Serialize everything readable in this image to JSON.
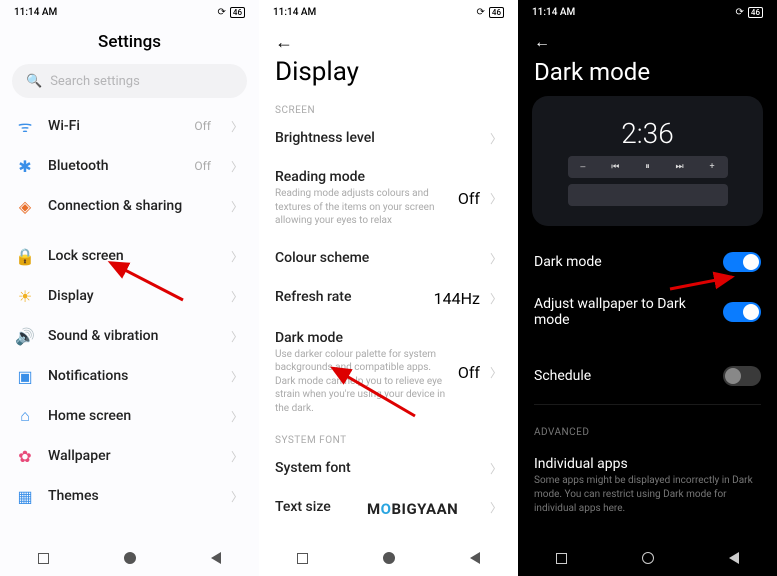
{
  "status": {
    "time": "11:14 AM",
    "batt": "46"
  },
  "p1": {
    "title": "Settings",
    "search_placeholder": "Search settings",
    "items": [
      {
        "icon": "wifi",
        "label": "Wi-Fi",
        "value": "Off",
        "color": "#3a8fe8"
      },
      {
        "icon": "bluetooth",
        "label": "Bluetooth",
        "value": "Off",
        "color": "#3a8fe8"
      },
      {
        "icon": "share",
        "label": "Connection & sharing",
        "value": "",
        "color": "#e86f2a"
      },
      {
        "gap": true
      },
      {
        "icon": "lock",
        "label": "Lock screen",
        "value": "",
        "color": "#e8502a"
      },
      {
        "icon": "sun",
        "label": "Display",
        "value": "",
        "color": "#f0b020"
      },
      {
        "icon": "sound",
        "label": "Sound & vibration",
        "value": "",
        "color": "#2fbf5a"
      },
      {
        "icon": "bell",
        "label": "Notifications",
        "value": "",
        "color": "#3a8fe8"
      },
      {
        "icon": "home",
        "label": "Home screen",
        "value": "",
        "color": "#3a8fe8"
      },
      {
        "icon": "flower",
        "label": "Wallpaper",
        "value": "",
        "color": "#e84a7a"
      },
      {
        "icon": "themes",
        "label": "Themes",
        "value": "",
        "color": "#3a8fe8"
      }
    ]
  },
  "p2": {
    "title": "Display",
    "section1": "SCREEN",
    "items": [
      {
        "title": "Brightness level",
        "desc": "",
        "value": ""
      },
      {
        "title": "Reading mode",
        "desc": "Reading mode adjusts colours and textures of the items on your screen allowing your eyes to relax",
        "value": "Off"
      },
      {
        "title": "Colour scheme",
        "desc": "",
        "value": ""
      },
      {
        "title": "Refresh rate",
        "desc": "",
        "value": "144Hz"
      },
      {
        "title": "Dark mode",
        "desc": "Use darker colour palette for system backgrounds and compatible apps. Dark mode can help you to relieve eye strain when you're using your device in the dark.",
        "value": "Off"
      }
    ],
    "section2": "SYSTEM FONT",
    "items2": [
      {
        "title": "System font",
        "value": ""
      },
      {
        "title": "Text size",
        "value": ""
      }
    ]
  },
  "p3": {
    "title": "Dark mode",
    "clock": "2:36",
    "rows": [
      {
        "label": "Dark mode",
        "on": true
      },
      {
        "label": "Adjust wallpaper to Dark mode",
        "on": true
      }
    ],
    "schedule": {
      "label": "Schedule",
      "on": false
    },
    "section": "ADVANCED",
    "indiv_title": "Individual apps",
    "indiv_desc": "Some apps might be displayed incorrectly in Dark mode. You can restrict using Dark mode for individual apps here."
  },
  "watermark": {
    "a": "M",
    "b": "O",
    "c": "BIGYAAN"
  }
}
